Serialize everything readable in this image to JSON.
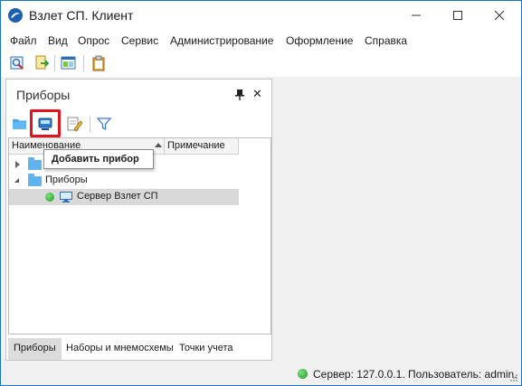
{
  "window": {
    "title": "Взлет СП. Клиент",
    "accent_color": "#1a73c8",
    "controls": {
      "minimize_icon": "minimize-icon",
      "maximize_icon": "maximize-icon",
      "close_icon": "close-icon"
    }
  },
  "menu": {
    "items": [
      "Файл",
      "Вид",
      "Опрос",
      "Сервис",
      "Администрирование",
      "Оформление",
      "Справка"
    ]
  },
  "toolbar": {
    "icons": [
      "connect-icon",
      "export-icon",
      "window-layout-icon",
      "clipboard-icon"
    ]
  },
  "panel": {
    "title": "Приборы",
    "pin_icon": "pin-icon",
    "close_glyph": "✕",
    "toolbar_icons": [
      "folder-icon",
      "add-device-icon",
      "edit-icon",
      "filter-icon"
    ],
    "highlight_color": "#e0141c",
    "columns": {
      "name": "Наименование",
      "note": "Примечание"
    },
    "tree": [
      {
        "label": "",
        "kind": "folder",
        "expanded": false
      },
      {
        "label": "Приборы",
        "kind": "folder",
        "expanded": true
      },
      {
        "label": "Сервер Взлет СП",
        "kind": "device",
        "status": "online",
        "selected": true
      }
    ],
    "tooltip": "Добавить прибор",
    "bottom_tabs": [
      "Приборы",
      "Наборы и мнемосхемы",
      "Точки учета"
    ],
    "active_tab": "Приборы"
  },
  "statusbar": {
    "text": "Сервер: 127.0.0.1. Пользователь: admin.",
    "status_color": "#2ca82c"
  }
}
